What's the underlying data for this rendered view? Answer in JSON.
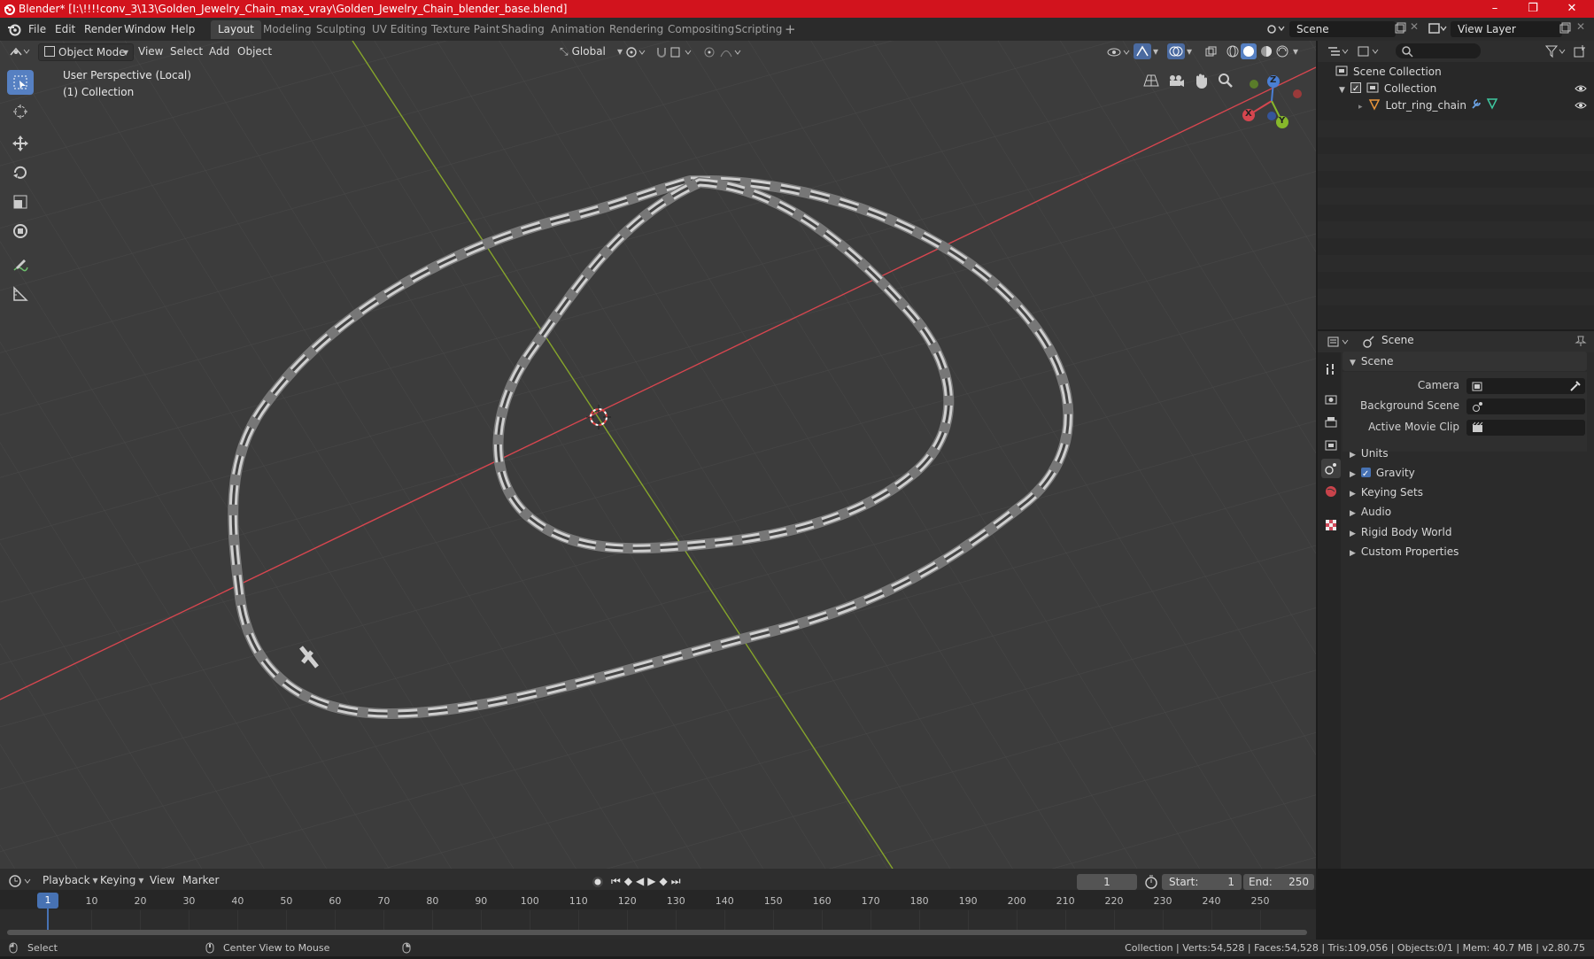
{
  "window": {
    "title": "Blender* [I:\\!!!!conv_3\\13\\Golden_Jewelry_Chain_max_vray\\Golden_Jewelry_Chain_blender_base.blend]",
    "controls": [
      "–",
      "❐",
      "✕"
    ]
  },
  "menu": [
    "File",
    "Edit",
    "Render",
    "Window",
    "Help"
  ],
  "workspaces": [
    "Layout",
    "Modeling",
    "Sculpting",
    "UV Editing",
    "Texture Paint",
    "Shading",
    "Animation",
    "Rendering",
    "Compositing",
    "Scripting"
  ],
  "active_workspace": "Layout",
  "scene_field": "Scene",
  "view_layer_field": "View Layer",
  "viewport": {
    "mode": "Object Mode",
    "menus": [
      "View",
      "Select",
      "Add",
      "Object"
    ],
    "orientation": "Global",
    "overlay_line1": "User Perspective (Local)",
    "overlay_line2": "(1) Collection",
    "gizmo_axes": [
      "X",
      "Y",
      "Z"
    ],
    "colors": {
      "background": "#3c3c3c",
      "x_axis": "#d6464f",
      "y_axis": "#86a52b",
      "chain": "#c9c9c9",
      "accent": "#5680c2"
    }
  },
  "outliner": {
    "root": "Scene Collection",
    "collection": "Collection",
    "object": "Lotr_ring_chain"
  },
  "properties": {
    "header": "Scene",
    "section": "Scene",
    "fields": [
      {
        "label": "Camera",
        "value": ""
      },
      {
        "label": "Background Scene",
        "value": ""
      },
      {
        "label": "Active Movie Clip",
        "value": ""
      }
    ],
    "panels": [
      "Units",
      "Gravity",
      "Keying Sets",
      "Audio",
      "Rigid Body World",
      "Custom Properties"
    ],
    "gravity_checked": true
  },
  "timeline": {
    "menus": [
      "Playback",
      "Keying",
      "View",
      "Marker"
    ],
    "current_frame": "1",
    "start_label": "Start:",
    "start": "1",
    "end_label": "End:",
    "end": "250",
    "ticks": [
      "1",
      "10",
      "20",
      "30",
      "40",
      "50",
      "60",
      "70",
      "80",
      "90",
      "100",
      "110",
      "120",
      "130",
      "140",
      "150",
      "160",
      "170",
      "180",
      "190",
      "200",
      "210",
      "220",
      "230",
      "240",
      "250"
    ]
  },
  "status": {
    "left1": "Select",
    "left2": "Center View to Mouse",
    "right": "Collection | Verts:54,528 | Faces:54,528 | Tris:109,056 | Objects:0/1 | Mem: 40.7 MB | v2.80.75"
  }
}
